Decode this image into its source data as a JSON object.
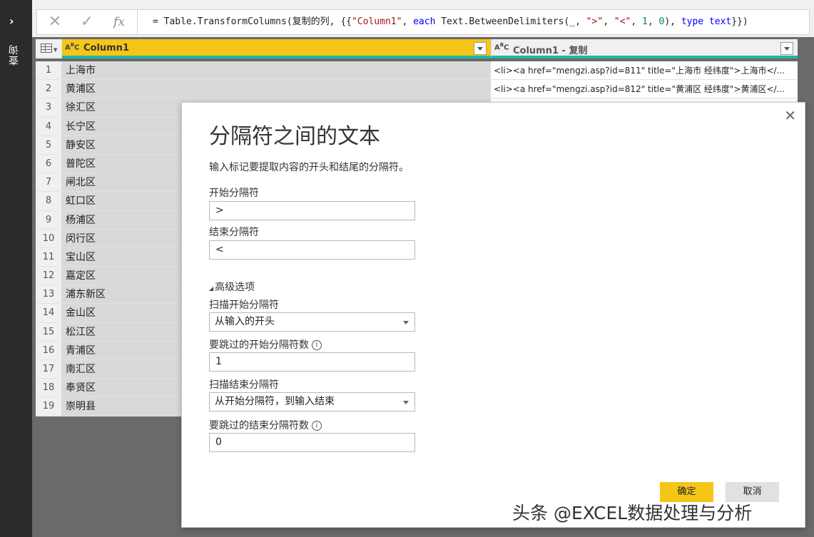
{
  "sidebar": {
    "chevron": "›",
    "label": "查询"
  },
  "formula": {
    "cancel_icon": "✕",
    "confirm_icon": "✓",
    "fx_icon": "fx",
    "parts": {
      "p1": "= Table.TransformColumns(复制的列, {{",
      "s1": "\"Column1\"",
      "p2": ", ",
      "k1": "each",
      "p3": " Text.BetweenDelimiters(_, ",
      "s2": "\">\"",
      "p4": ", ",
      "s3": "\"<\"",
      "p5": ", ",
      "n1": "1",
      "p6": ", ",
      "n2": "0",
      "p7": "), ",
      "k2": "type",
      "p8": " ",
      "k3": "text",
      "p9": "}})"
    }
  },
  "grid": {
    "columns": [
      {
        "type_icon": "ABC",
        "name": "Column1"
      },
      {
        "type_icon": "ABC",
        "name": "Column1 - 复制"
      }
    ],
    "rows": [
      {
        "n": "1",
        "c1": "上海市",
        "c2": "<li><a href=\"mengzi.asp?id=811\" title=\"上海市 经纬度\">上海市</..."
      },
      {
        "n": "2",
        "c1": "黄浦区",
        "c2": "<li><a href=\"mengzi.asp?id=812\" title=\"黄浦区 经纬度\">黄浦区</..."
      },
      {
        "n": "3",
        "c1": "徐汇区",
        "c2": ""
      },
      {
        "n": "4",
        "c1": "长宁区",
        "c2": ""
      },
      {
        "n": "5",
        "c1": "静安区",
        "c2": ""
      },
      {
        "n": "6",
        "c1": "普陀区",
        "c2": ""
      },
      {
        "n": "7",
        "c1": "闸北区",
        "c2": ""
      },
      {
        "n": "8",
        "c1": "虹口区",
        "c2": ""
      },
      {
        "n": "9",
        "c1": "杨浦区",
        "c2": ""
      },
      {
        "n": "10",
        "c1": "闵行区",
        "c2": ""
      },
      {
        "n": "11",
        "c1": "宝山区",
        "c2": ""
      },
      {
        "n": "12",
        "c1": "嘉定区",
        "c2": ""
      },
      {
        "n": "13",
        "c1": "浦东新区",
        "c2": ""
      },
      {
        "n": "14",
        "c1": "金山区",
        "c2": ""
      },
      {
        "n": "15",
        "c1": "松江区",
        "c2": ""
      },
      {
        "n": "16",
        "c1": "青浦区",
        "c2": ""
      },
      {
        "n": "17",
        "c1": "南汇区",
        "c2": ""
      },
      {
        "n": "18",
        "c1": "奉贤区",
        "c2": ""
      },
      {
        "n": "19",
        "c1": "崇明县",
        "c2": ""
      }
    ]
  },
  "dialog": {
    "title": "分隔符之间的文本",
    "description": "输入标记要提取内容的开头和结尾的分隔符。",
    "start_label": "开始分隔符",
    "start_value": ">",
    "end_label": "结束分隔符",
    "end_value": "<",
    "advanced_label": "高级选项",
    "scan_start_label": "扫描开始分隔符",
    "scan_start_value": "从输入的开头",
    "skip_start_label": "要跳过的开始分隔符数",
    "skip_start_value": "1",
    "scan_end_label": "扫描结束分隔符",
    "scan_end_value": "从开始分隔符，到输入结束",
    "skip_end_label": "要跳过的结束分隔符数",
    "skip_end_value": "0",
    "ok_label": "确定",
    "cancel_label": "取消",
    "close_icon": "✕",
    "info_icon": "i"
  },
  "watermark": "头条 @EXCEL数据处理与分析",
  "colors": {
    "accent": "#f5c518",
    "teal": "#1fb8a8",
    "sidebar_bg": "#2b2b2b"
  }
}
